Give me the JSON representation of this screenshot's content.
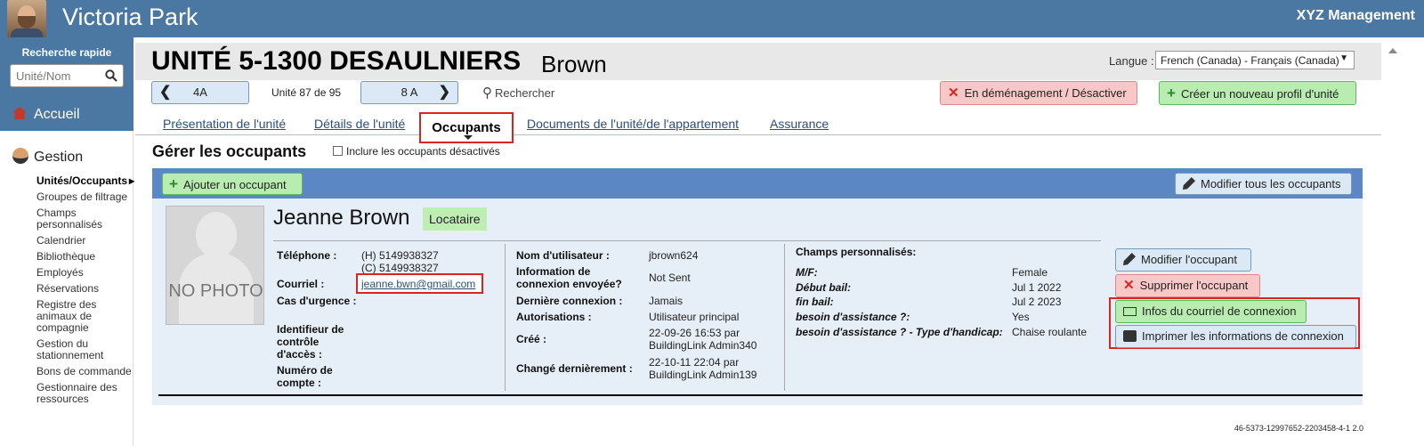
{
  "header": {
    "app_title": "Victoria Park",
    "company": "XYZ Management"
  },
  "sidebar": {
    "quick_search_title": "Recherche rapide",
    "quick_search_placeholder": "Unité/Nom",
    "home": "Accueil",
    "section": "Gestion",
    "items": [
      {
        "label": "Unités/Occupants",
        "active": true
      },
      {
        "label": "Groupes de filtrage"
      },
      {
        "label": "Champs personnalisés"
      },
      {
        "label": "Calendrier"
      },
      {
        "label": "Bibliothèque"
      },
      {
        "label": "Employés"
      },
      {
        "label": "Réservations"
      },
      {
        "label": "Registre des animaux de compagnie"
      },
      {
        "label": "Gestion du stationnement"
      },
      {
        "label": "Bons de commande"
      },
      {
        "label": "Gestionnaire des ressources"
      }
    ]
  },
  "unit": {
    "title": "UNITÉ 5-1300 DESAULNIERS",
    "owner": "Brown",
    "language_label": "Langue :",
    "language_value": "French (Canada) - Français (Canada)",
    "prev_unit": "4A",
    "unit_position": "Unité 87 de 95",
    "next_unit": "8 A",
    "search_label": "Rechercher",
    "deactivate_label": "En déménagement / Désactiver",
    "create_profile_label": "Créer un nouveau profil d'unité"
  },
  "tabs": {
    "presentation": "Présentation de l'unité",
    "details": "Détails de l'unité",
    "occupants": "Occupants",
    "documents": "Documents de l'unité/de l'appartement",
    "insurance": "Assurance"
  },
  "occupants_section": {
    "title": "Gérer les occupants",
    "include_deactivated": "Inclure les occupants désactivés",
    "add_button": "Ajouter un occupant",
    "edit_all_button": "Modifier tous les occupants"
  },
  "occupant": {
    "photo_text": "NO PHOTO",
    "name": "Jeanne Brown",
    "role": "Locataire",
    "phone_label": "Téléphone :",
    "phone_h": "(H) 5149938327",
    "phone_c": "(C) 5149938327",
    "email_label": "Courriel :",
    "email": "jeanne.bwn@gmail.com",
    "emergency_label": "Cas d'urgence :",
    "access_id_label": "Identifieur de contrôle d'accès :",
    "account_label": "Numéro de compte :",
    "username_label": "Nom d'utilisateur :",
    "username": "jbrown624",
    "login_info_label": "Information de connexion envoyée?",
    "login_info": "Not Sent",
    "last_login_label": "Dernière connexion :",
    "last_login": "Jamais",
    "permissions_label": "Autorisations :",
    "permissions": "Utilisateur principal",
    "created_label": "Créé :",
    "created": "22-09-26 16:53 par BuildingLink Admin340",
    "modified_label": "Changé dernièrement :",
    "modified": "22-10-11 22:04 par BuildingLink Admin139",
    "custom_fields_title": "Champs personnalisés:",
    "custom_fields": [
      {
        "label": "M/F:",
        "value": "Female"
      },
      {
        "label": "Début bail:",
        "value": "Jul 1 2022"
      },
      {
        "label": "fin bail:",
        "value": "Jul 2 2023"
      },
      {
        "label": "besoin d'assistance ?:",
        "value": "Yes"
      },
      {
        "label": "besoin d'assistance ? - Type d'handicap:",
        "value": "Chaise roulante"
      }
    ],
    "edit_button": "Modifier l'occupant",
    "delete_button": "Supprimer l'occupant",
    "email_login_button": "Infos du courriel de connexion",
    "print_login_button": "Imprimer les informations de connexion"
  },
  "footer": {
    "build_id": "46-5373-12997652-2203458-4-1 2.0"
  }
}
